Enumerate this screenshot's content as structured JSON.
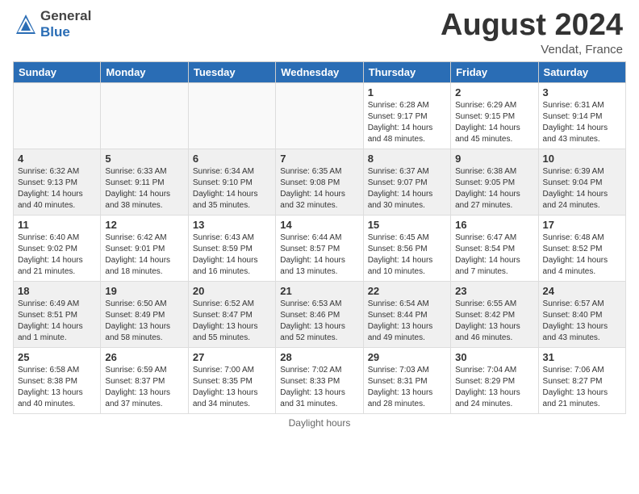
{
  "header": {
    "logo_general": "General",
    "logo_blue": "Blue",
    "title": "August 2024",
    "subtitle": "Vendat, France"
  },
  "days_of_week": [
    "Sunday",
    "Monday",
    "Tuesday",
    "Wednesday",
    "Thursday",
    "Friday",
    "Saturday"
  ],
  "footer_note": "Daylight hours",
  "weeks": [
    [
      {
        "num": "",
        "info": "",
        "empty": true
      },
      {
        "num": "",
        "info": "",
        "empty": true
      },
      {
        "num": "",
        "info": "",
        "empty": true
      },
      {
        "num": "",
        "info": "",
        "empty": true
      },
      {
        "num": "1",
        "info": "Sunrise: 6:28 AM\nSunset: 9:17 PM\nDaylight: 14 hours\nand 48 minutes."
      },
      {
        "num": "2",
        "info": "Sunrise: 6:29 AM\nSunset: 9:15 PM\nDaylight: 14 hours\nand 45 minutes."
      },
      {
        "num": "3",
        "info": "Sunrise: 6:31 AM\nSunset: 9:14 PM\nDaylight: 14 hours\nand 43 minutes."
      }
    ],
    [
      {
        "num": "4",
        "info": "Sunrise: 6:32 AM\nSunset: 9:13 PM\nDaylight: 14 hours\nand 40 minutes.",
        "shaded": true
      },
      {
        "num": "5",
        "info": "Sunrise: 6:33 AM\nSunset: 9:11 PM\nDaylight: 14 hours\nand 38 minutes.",
        "shaded": true
      },
      {
        "num": "6",
        "info": "Sunrise: 6:34 AM\nSunset: 9:10 PM\nDaylight: 14 hours\nand 35 minutes.",
        "shaded": true
      },
      {
        "num": "7",
        "info": "Sunrise: 6:35 AM\nSunset: 9:08 PM\nDaylight: 14 hours\nand 32 minutes.",
        "shaded": true
      },
      {
        "num": "8",
        "info": "Sunrise: 6:37 AM\nSunset: 9:07 PM\nDaylight: 14 hours\nand 30 minutes.",
        "shaded": true
      },
      {
        "num": "9",
        "info": "Sunrise: 6:38 AM\nSunset: 9:05 PM\nDaylight: 14 hours\nand 27 minutes.",
        "shaded": true
      },
      {
        "num": "10",
        "info": "Sunrise: 6:39 AM\nSunset: 9:04 PM\nDaylight: 14 hours\nand 24 minutes.",
        "shaded": true
      }
    ],
    [
      {
        "num": "11",
        "info": "Sunrise: 6:40 AM\nSunset: 9:02 PM\nDaylight: 14 hours\nand 21 minutes."
      },
      {
        "num": "12",
        "info": "Sunrise: 6:42 AM\nSunset: 9:01 PM\nDaylight: 14 hours\nand 18 minutes."
      },
      {
        "num": "13",
        "info": "Sunrise: 6:43 AM\nSunset: 8:59 PM\nDaylight: 14 hours\nand 16 minutes."
      },
      {
        "num": "14",
        "info": "Sunrise: 6:44 AM\nSunset: 8:57 PM\nDaylight: 14 hours\nand 13 minutes."
      },
      {
        "num": "15",
        "info": "Sunrise: 6:45 AM\nSunset: 8:56 PM\nDaylight: 14 hours\nand 10 minutes."
      },
      {
        "num": "16",
        "info": "Sunrise: 6:47 AM\nSunset: 8:54 PM\nDaylight: 14 hours\nand 7 minutes."
      },
      {
        "num": "17",
        "info": "Sunrise: 6:48 AM\nSunset: 8:52 PM\nDaylight: 14 hours\nand 4 minutes."
      }
    ],
    [
      {
        "num": "18",
        "info": "Sunrise: 6:49 AM\nSunset: 8:51 PM\nDaylight: 14 hours\nand 1 minute.",
        "shaded": true
      },
      {
        "num": "19",
        "info": "Sunrise: 6:50 AM\nSunset: 8:49 PM\nDaylight: 13 hours\nand 58 minutes.",
        "shaded": true
      },
      {
        "num": "20",
        "info": "Sunrise: 6:52 AM\nSunset: 8:47 PM\nDaylight: 13 hours\nand 55 minutes.",
        "shaded": true
      },
      {
        "num": "21",
        "info": "Sunrise: 6:53 AM\nSunset: 8:46 PM\nDaylight: 13 hours\nand 52 minutes.",
        "shaded": true
      },
      {
        "num": "22",
        "info": "Sunrise: 6:54 AM\nSunset: 8:44 PM\nDaylight: 13 hours\nand 49 minutes.",
        "shaded": true
      },
      {
        "num": "23",
        "info": "Sunrise: 6:55 AM\nSunset: 8:42 PM\nDaylight: 13 hours\nand 46 minutes.",
        "shaded": true
      },
      {
        "num": "24",
        "info": "Sunrise: 6:57 AM\nSunset: 8:40 PM\nDaylight: 13 hours\nand 43 minutes.",
        "shaded": true
      }
    ],
    [
      {
        "num": "25",
        "info": "Sunrise: 6:58 AM\nSunset: 8:38 PM\nDaylight: 13 hours\nand 40 minutes."
      },
      {
        "num": "26",
        "info": "Sunrise: 6:59 AM\nSunset: 8:37 PM\nDaylight: 13 hours\nand 37 minutes."
      },
      {
        "num": "27",
        "info": "Sunrise: 7:00 AM\nSunset: 8:35 PM\nDaylight: 13 hours\nand 34 minutes."
      },
      {
        "num": "28",
        "info": "Sunrise: 7:02 AM\nSunset: 8:33 PM\nDaylight: 13 hours\nand 31 minutes."
      },
      {
        "num": "29",
        "info": "Sunrise: 7:03 AM\nSunset: 8:31 PM\nDaylight: 13 hours\nand 28 minutes."
      },
      {
        "num": "30",
        "info": "Sunrise: 7:04 AM\nSunset: 8:29 PM\nDaylight: 13 hours\nand 24 minutes."
      },
      {
        "num": "31",
        "info": "Sunrise: 7:06 AM\nSunset: 8:27 PM\nDaylight: 13 hours\nand 21 minutes."
      }
    ]
  ]
}
